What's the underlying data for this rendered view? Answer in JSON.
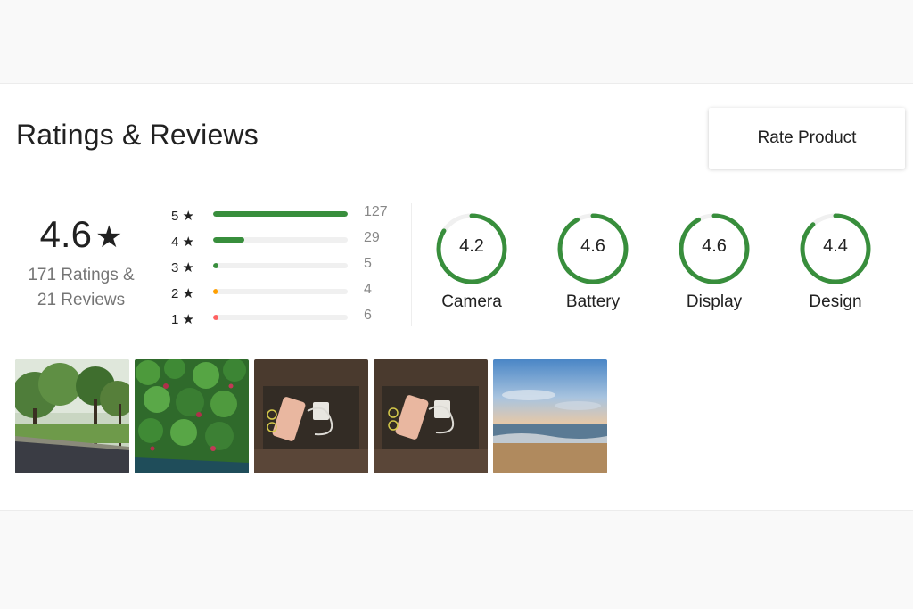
{
  "section": {
    "title": "Ratings & Reviews",
    "rate_button_label": "Rate Product"
  },
  "overall": {
    "average": "4.6",
    "star_glyph": "★",
    "ratings_line": "171 Ratings &",
    "reviews_line": "21 Reviews"
  },
  "distribution": [
    {
      "stars": "5 ★",
      "count": "127",
      "fraction": 1.0,
      "color": "#388e3c"
    },
    {
      "stars": "4 ★",
      "count": "29",
      "fraction": 0.23,
      "color": "#388e3c"
    },
    {
      "stars": "3 ★",
      "count": "5",
      "fraction": 0.04,
      "color": "#388e3c"
    },
    {
      "stars": "2 ★",
      "count": "4",
      "fraction": 0.03,
      "color": "#ff9f00"
    },
    {
      "stars": "1 ★",
      "count": "6",
      "fraction": 0.04,
      "color": "#ff6161"
    }
  ],
  "aspects": [
    {
      "name": "Camera",
      "value": "4.2",
      "score": 4.2
    },
    {
      "name": "Battery",
      "value": "4.6",
      "score": 4.6
    },
    {
      "name": "Display",
      "value": "4.6",
      "score": 4.6
    },
    {
      "name": "Design",
      "value": "4.4",
      "score": 4.4
    }
  ],
  "colors": {
    "accent_green": "#388e3c",
    "gauge_track": "#f0f0f0"
  },
  "photos": [
    {
      "name": "photo-tree-lined-road"
    },
    {
      "name": "photo-green-foliage"
    },
    {
      "name": "photo-phone-box-contents"
    },
    {
      "name": "photo-phone-box-contents-2"
    },
    {
      "name": "photo-beach-sunset"
    }
  ]
}
